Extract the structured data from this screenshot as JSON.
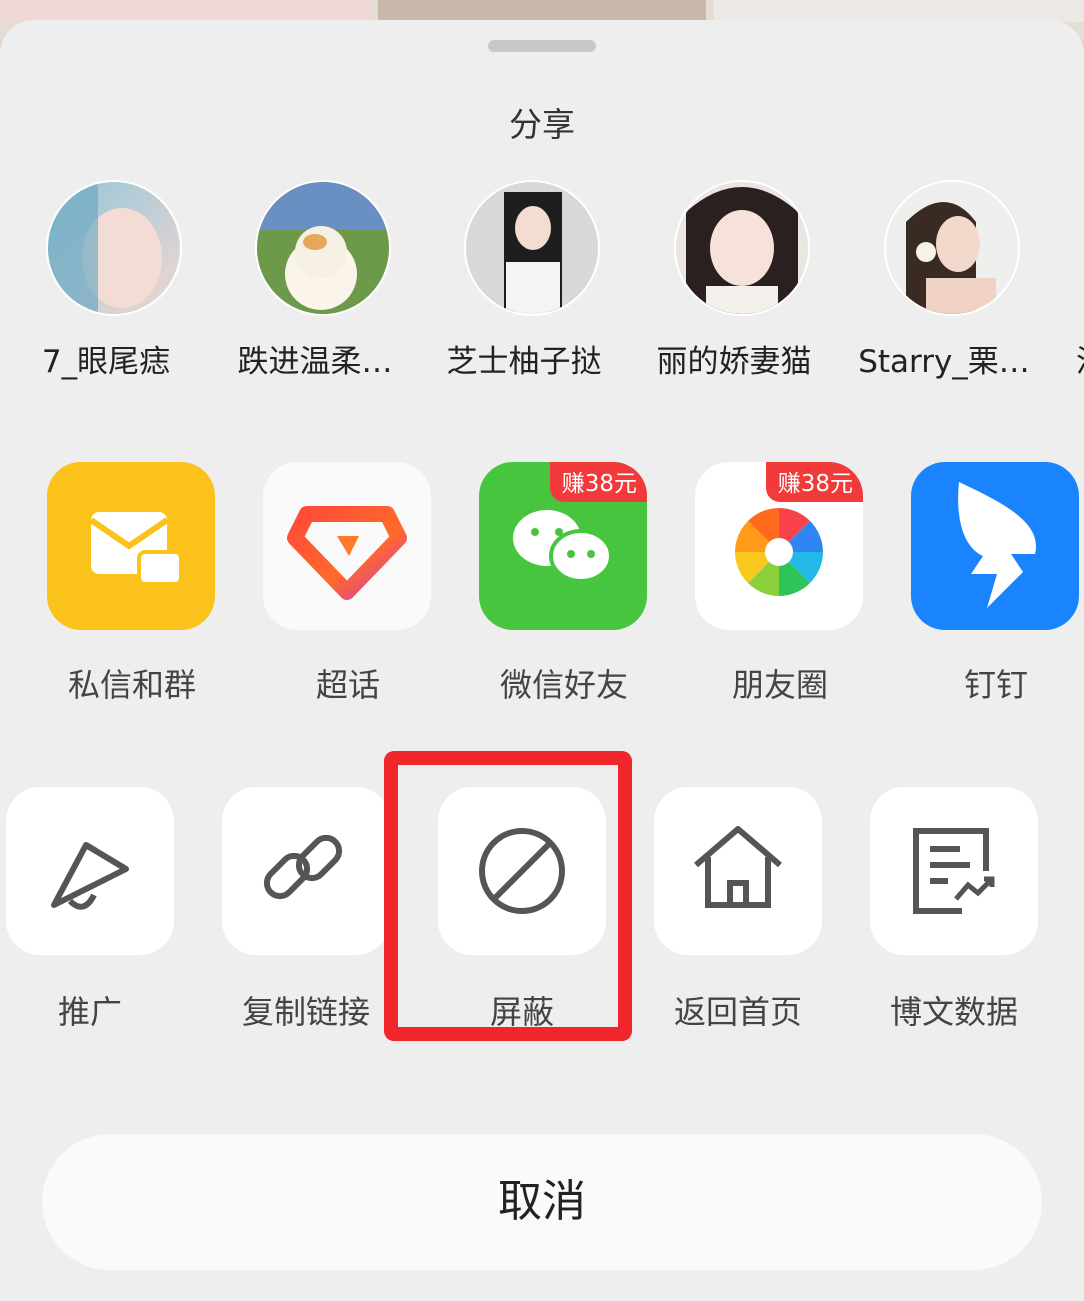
{
  "sheet": {
    "title": "分享"
  },
  "contacts": [
    {
      "name": "7_眼尾痣",
      "avatar": "avatar-1"
    },
    {
      "name": "跌进温柔…",
      "avatar": "avatar-2"
    },
    {
      "name": "芝士柚子挞",
      "avatar": "avatar-3"
    },
    {
      "name": "丽的娇妻猫",
      "avatar": "avatar-4"
    },
    {
      "name": "Starry_栗…",
      "avatar": "avatar-5"
    },
    {
      "name": "泸",
      "avatar": "avatar-6"
    }
  ],
  "apps": [
    {
      "label": "私信和群",
      "icon": "mail-chat-icon",
      "color": "#fbc21b"
    },
    {
      "label": "超话",
      "icon": "diamond-icon",
      "color": "#ffffff"
    },
    {
      "label": "微信好友",
      "icon": "wechat-icon",
      "color": "#47c53f",
      "badge": "赚38元"
    },
    {
      "label": "朋友圈",
      "icon": "moments-icon",
      "color": "#ffffff",
      "badge": "赚38元"
    },
    {
      "label": "钉钉",
      "icon": "dingtalk-icon",
      "color": "#1a84ff"
    }
  ],
  "actions": [
    {
      "label": "推广",
      "icon": "megaphone-icon"
    },
    {
      "label": "复制链接",
      "icon": "link-icon"
    },
    {
      "label": "屏蔽",
      "icon": "block-icon",
      "highlighted": true
    },
    {
      "label": "返回首页",
      "icon": "home-icon"
    },
    {
      "label": "博文数据",
      "icon": "data-report-icon"
    }
  ],
  "cancel_label": "取消",
  "colors": {
    "highlight": "#f0262b",
    "sheet_bg": "#eeeeee",
    "badge": "#f23a3a"
  }
}
